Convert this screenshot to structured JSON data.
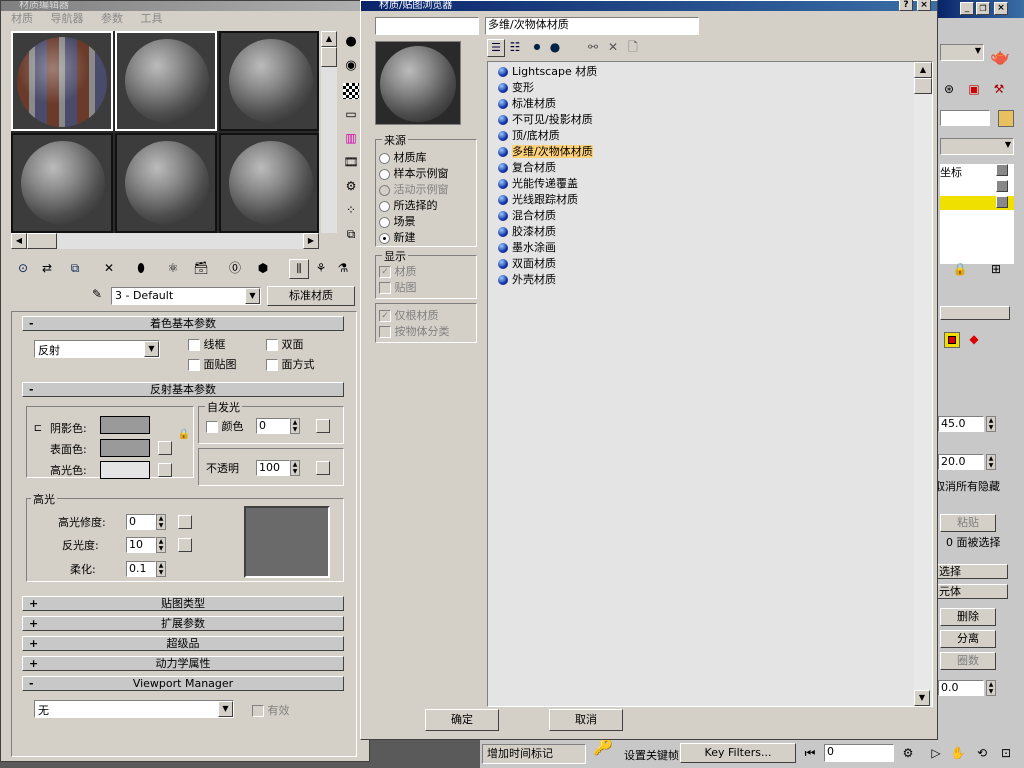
{
  "me": {
    "title": "材质编辑器",
    "menu": [
      "材质",
      "导航器",
      "参数",
      "工具"
    ],
    "material_name": "3 - Default",
    "material_type": "标准材质",
    "rollouts": {
      "shader_basic": "着色基本参数",
      "reflect_basic": "反射基本参数",
      "maps": "贴图类型",
      "extended": "扩展参数",
      "supersampling": "超级品",
      "dynamics": "动力学属性",
      "viewport": "Viewport Manager"
    },
    "shader": {
      "type": "反射",
      "wire": "线框",
      "two_sided": "双面",
      "face_map": "面贴图",
      "faceted": "面方式"
    },
    "colors": {
      "ambient_label": "阴影色:",
      "diffuse_label": "表面色:",
      "specular_label": "高光色:",
      "ambient": "#9a9a9a",
      "diffuse": "#9a9a9a",
      "specular": "#e4e4e4"
    },
    "self_illum": {
      "title": "自发光",
      "color_label": "颜色",
      "value": "0"
    },
    "opacity": {
      "label": "不透明",
      "value": "100"
    },
    "specular_highlights": {
      "title": "高光",
      "level_label": "高光修度:",
      "level": "0",
      "gloss_label": "反光度:",
      "gloss": "10",
      "soften_label": "柔化:",
      "soften": "0.1"
    },
    "viewport": {
      "value": "无",
      "enable_label": "有效"
    }
  },
  "browser": {
    "title": "材质/贴图浏览器",
    "selected_name": "多维/次物体材质",
    "source_title": "来源",
    "sources": [
      "材质库",
      "样本示例窗",
      "活动示例窗",
      "所选择的",
      "场景",
      "新建"
    ],
    "selected_source": 5,
    "display_title": "显示",
    "display": [
      "材质",
      "贴图"
    ],
    "filter": [
      "仅根材质",
      "按物体分类"
    ],
    "items": [
      "Lightscape 材质",
      "变形",
      "标准材质",
      "不可见/投影材质",
      "顶/底材质",
      "多维/次物体材质",
      "复合材质",
      "光能传递覆盖",
      "光线跟踪材质",
      "混合材质",
      "胶漆材质",
      "墨水涂画",
      "双面材质",
      "外壳材质"
    ],
    "selected_item": 5,
    "ok": "确定",
    "cancel": "取消"
  },
  "right_panel": {
    "value1": "45.0",
    "value2": "20.0",
    "unhide_all": "取消所有隐藏",
    "paste": "粘贴",
    "faces_selected": "0 面被选择",
    "select": "选择",
    "element": "元体",
    "delete": "删除",
    "detach": "分离",
    "rings": "圈数",
    "value3": "0.0",
    "coord_label": "坐标"
  },
  "bottom_bar": {
    "add_time_tag": "增加时间标记",
    "set_key": "设置关键帧",
    "key_filters": "Key Filters...",
    "frame": "0"
  }
}
